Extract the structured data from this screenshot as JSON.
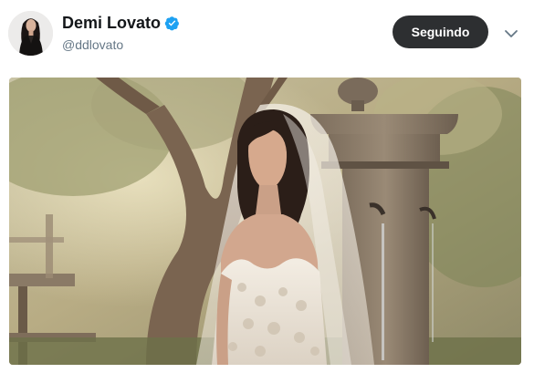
{
  "tweet": {
    "author": {
      "display_name": "Demi Lovato",
      "handle": "@ddlovato",
      "verified": true,
      "avatar_icon": "profile-avatar"
    },
    "follow_button": {
      "label": "Seguindo"
    },
    "menu": {
      "icon": "chevron-down-icon"
    },
    "media": {
      "type": "photo",
      "alt": "Bride in a lace gown and long veil standing beside a stone fountain in a sunlit garden"
    }
  },
  "colors": {
    "name": "#14171a",
    "handle": "#657786",
    "verified": "#1da1f2",
    "button_bg": "#2d2f31",
    "button_text": "#ffffff"
  }
}
